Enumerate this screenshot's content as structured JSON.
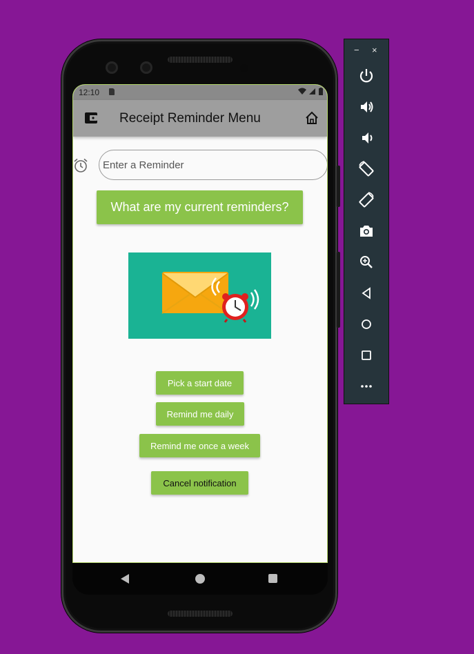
{
  "status_bar": {
    "time": "12:10"
  },
  "app_bar": {
    "title": "Receipt Reminder Menu"
  },
  "reminder": {
    "placeholder": "Enter a Reminder"
  },
  "buttons": {
    "current_reminders": "What are my current reminders?",
    "start_date": "Pick a start date",
    "remind_daily": "Remind me daily",
    "remind_weekly": "Remind me once a week",
    "cancel": "Cancel notification"
  },
  "emulator_toolbar": {
    "minimize": "−",
    "close": "×",
    "controls": [
      "power-icon",
      "volume-up-icon",
      "volume-down-icon",
      "rotate-left-icon",
      "rotate-right-icon",
      "camera-icon",
      "zoom-icon",
      "back-icon",
      "home-icon",
      "overview-icon",
      "more-icon"
    ]
  },
  "colors": {
    "background": "#861795",
    "accent_green": "#8bc34a",
    "app_bar": "#9e9e9e",
    "illustration_bg": "#1ab394"
  }
}
